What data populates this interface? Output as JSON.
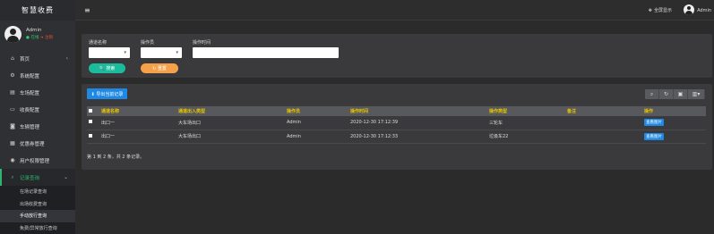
{
  "app": {
    "title": "智慧收费"
  },
  "user": {
    "name": "Admin",
    "online": "● 在线",
    "logout": "➔ 注销"
  },
  "topbar": {
    "fullscreen": "全屏显示",
    "username": "Admin"
  },
  "sidebar": {
    "items": [
      {
        "label": "首页",
        "icon": "home-icon"
      },
      {
        "label": "系统配置",
        "icon": "gear-icon"
      },
      {
        "label": "车场配置",
        "icon": "doc-icon"
      },
      {
        "label": "收费配置",
        "icon": "money-icon"
      },
      {
        "label": "车辆管理",
        "icon": "car-icon"
      },
      {
        "label": "优惠券管理",
        "icon": "coupon-icon"
      },
      {
        "label": "用户权限管理",
        "icon": "user-icon"
      },
      {
        "label": "记录查询",
        "icon": "search-icon"
      }
    ],
    "subitems": [
      "在场记录查询",
      "出场收费查询",
      "手动放行查询",
      "免费/异常放行查询"
    ]
  },
  "search": {
    "channel_label": "通道名称",
    "operator_label": "操作员",
    "time_label": "操作时间",
    "search_btn": "🔍 搜索",
    "reset_btn": "↻ 重置"
  },
  "table": {
    "export_btn": "⬇ 导出当前记录",
    "headers": [
      "通道名称",
      "通道出入类型",
      "操作员",
      "操作时间",
      "操作类型",
      "备注",
      "操作"
    ],
    "rows": [
      {
        "channel": "出口一",
        "type": "大车场出口",
        "operator": "Admin",
        "time": "2020-12-30 17:12:39",
        "optype": "三轮车",
        "note": "",
        "action": "查看图片"
      },
      {
        "channel": "出口一",
        "type": "大车场出口",
        "operator": "Admin",
        "time": "2020-12-30 17:12:33",
        "optype": "垃圾车22",
        "note": "",
        "action": "查看图片"
      }
    ],
    "pageinfo": "第 1 到 2 条，共 2 条记录。"
  },
  "colors": {
    "accent_green": "#1abc9c",
    "accent_orange": "#f5a14a",
    "header_text": "#e8c600",
    "button_blue": "#1e88e5"
  }
}
